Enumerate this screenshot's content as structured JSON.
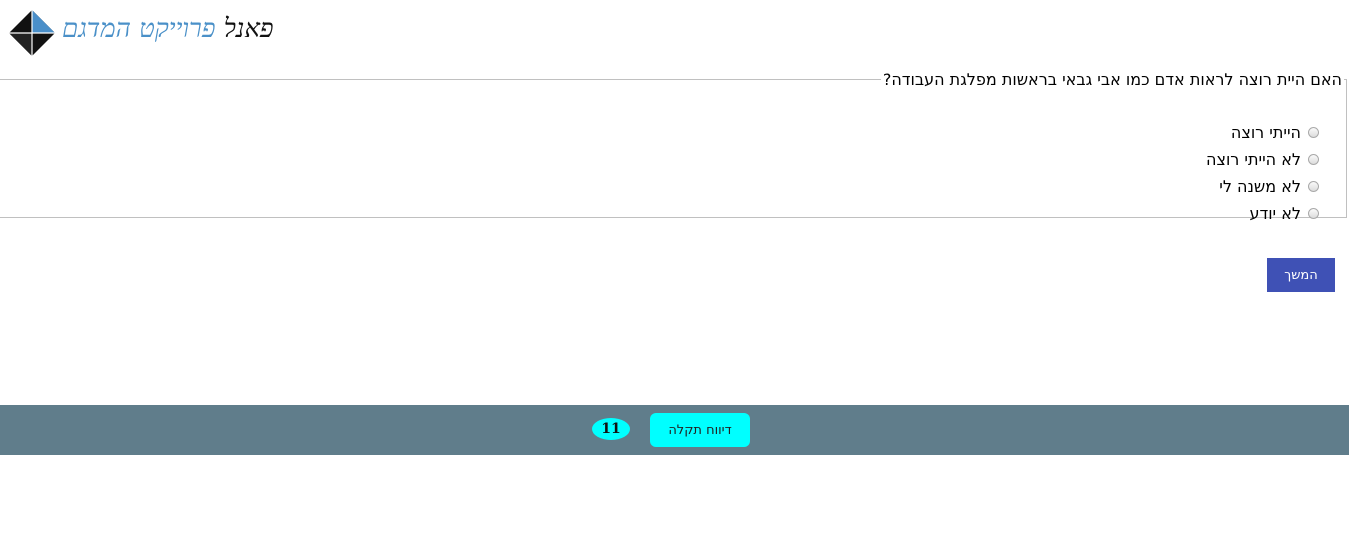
{
  "logo": {
    "text_black": "פאנל",
    "text_blue": "פרוייקט המדגם"
  },
  "question": {
    "text": "האם היית רוצה לראות אדם כמו אבי גבאי בראשות מפלגת העבודה?",
    "options": [
      {
        "label": "הייתי רוצה",
        "selected": false
      },
      {
        "label": "לא הייתי רוצה",
        "selected": false
      },
      {
        "label": "לא משנה לי",
        "selected": false
      },
      {
        "label": "לא יודע",
        "selected": false
      }
    ]
  },
  "next_button": {
    "label": "המשך"
  },
  "footer": {
    "report_button": "דיווח תקלה",
    "count_badge": "11"
  },
  "colors": {
    "next_button_bg": "#3f51b5",
    "footer_bg": "#607d8b",
    "report_button_bg": "#00ffff",
    "logo_blue": "#4a90c8"
  }
}
